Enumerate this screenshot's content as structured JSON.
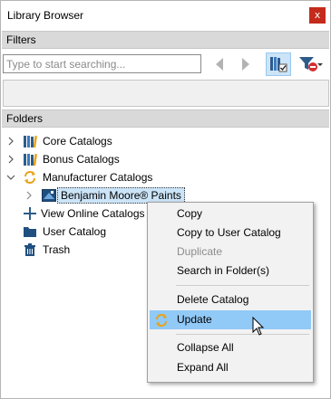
{
  "window": {
    "title": "Library Browser",
    "close_label": "x"
  },
  "filters": {
    "header": "Filters",
    "search_placeholder": "Type to start searching..."
  },
  "folders": {
    "header": "Folders",
    "items": [
      {
        "label": "Core Catalogs",
        "icon": "books-icon"
      },
      {
        "label": "Bonus Catalogs",
        "icon": "books-icon"
      },
      {
        "label": "Manufacturer Catalogs",
        "icon": "sync-icon"
      },
      {
        "label": "Benjamin Moore® Paints",
        "icon": "catalog-icon"
      },
      {
        "label": "View Online Catalogs",
        "icon": "plus-icon"
      },
      {
        "label": "User Catalog",
        "icon": "folder-icon"
      },
      {
        "label": "Trash",
        "icon": "trash-icon"
      }
    ]
  },
  "context_menu": {
    "items": [
      {
        "label": "Copy"
      },
      {
        "label": "Copy to User Catalog"
      },
      {
        "label": "Duplicate"
      },
      {
        "label": "Search in Folder(s)"
      },
      {
        "label": "Delete Catalog"
      },
      {
        "label": "Update"
      },
      {
        "label": "Collapse All"
      },
      {
        "label": "Expand All"
      }
    ]
  },
  "colors": {
    "close_red": "#c42b1c",
    "section_header": "#d9d9d9",
    "menu_hover": "#91c9f7",
    "selection": "#cce4f7",
    "sync_orange": "#e8a317"
  }
}
